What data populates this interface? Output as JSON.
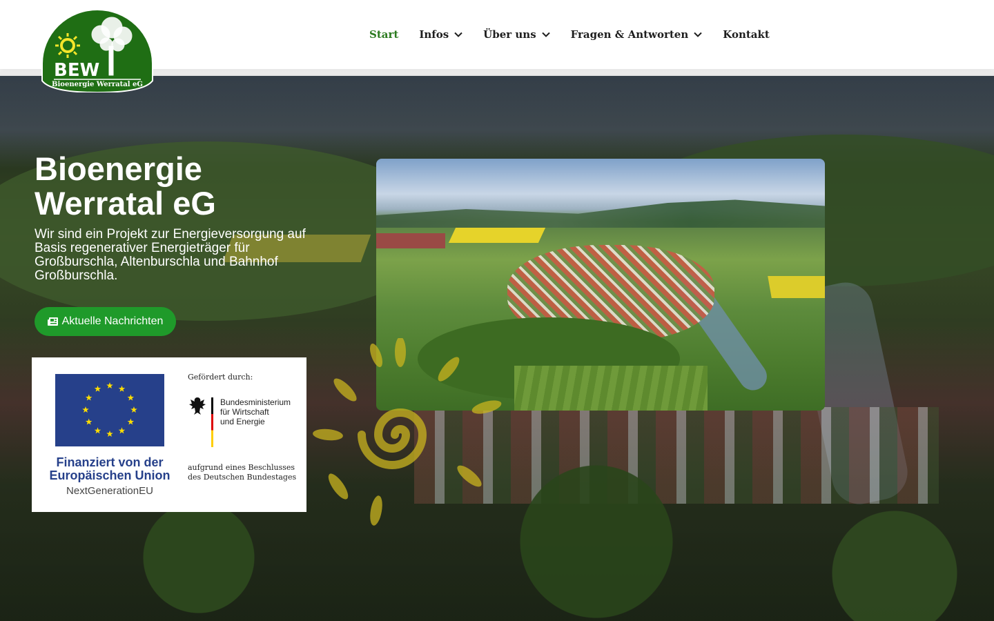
{
  "logo": {
    "initials": "BEW",
    "name": "Bioenergie Werratal eG"
  },
  "nav": {
    "items": [
      {
        "label": "Start",
        "active": true,
        "has_dropdown": false
      },
      {
        "label": "Infos",
        "active": false,
        "has_dropdown": true
      },
      {
        "label": "Über uns",
        "active": false,
        "has_dropdown": true
      },
      {
        "label": "Fragen & Antworten",
        "active": false,
        "has_dropdown": true
      },
      {
        "label": "Kontakt",
        "active": false,
        "has_dropdown": false
      }
    ]
  },
  "hero": {
    "title": "Bioenergie Werratal eG",
    "text": "Wir sind ein Projekt zur Energieversorgung auf Basis regenerativer Energieträger für Großburschla, Altenburschla und Bahnhof Großburschla.",
    "button_label": "Aktuelle Nachrichten",
    "button_icon": "newspaper-icon"
  },
  "funding": {
    "eu_line1": "Finanziert von der",
    "eu_line2": "Europäischen Union",
    "eu_line3": "NextGenerationEU",
    "bmwi_heading": "Gefördert durch:",
    "bmwi_name": "Bundesministerium\nfür Wirtschaft\nund Energie",
    "bmwi_footer": "aufgrund eines Beschlusses\ndes Deutschen Bundestages"
  },
  "colors": {
    "brand_green": "#1f6e14",
    "active_nav": "#2b7a1f",
    "button_green": "#1f9a2a",
    "eu_blue": "#26408a",
    "eu_star": "#ffdd00"
  }
}
